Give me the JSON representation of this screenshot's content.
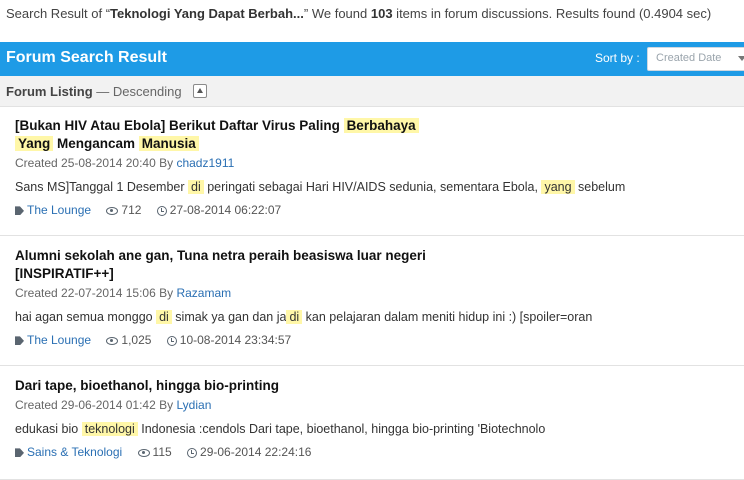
{
  "search_summary": {
    "prefix": "Search Result of “",
    "query": "Teknologi Yang Dapat Berbah...",
    "middle": "” We found ",
    "count": "103",
    "suffix": " items in forum discussions. Results found (0.4904 sec)"
  },
  "header": {
    "title": "Forum Search Result",
    "sort_label": "Sort by :",
    "sort_value": "Created Date"
  },
  "listing": {
    "label": "Forum Listing",
    "order": " — Descending"
  },
  "results": [
    {
      "title_parts": [
        "[Bukan HIV Atau Ebola] Berikut Daftar Virus Paling ",
        "Berbahaya",
        "Yang",
        " Mengancam ",
        "Manusia"
      ],
      "created_text": "Created 25-08-2014 20:40 By ",
      "author": "chadz1911",
      "snippet_parts": [
        "Sans MS]Tanggal 1 Desember ",
        "di",
        " peringati sebagai Hari HIV/AIDS sedunia, sementara Ebola, ",
        "yang",
        " sebelum"
      ],
      "forum": "The Lounge",
      "views": "712",
      "last_post": "27-08-2014 06:22:07"
    },
    {
      "title": "Alumni sekolah ane gan, Tuna netra peraih beasiswa luar negeri [INSPIRATIF++]",
      "created_text": "Created 22-07-2014 15:06 By ",
      "author": "Razamam",
      "snippet_parts": [
        "hai agan semua monggo ",
        "di",
        " simak ya gan dan ja",
        "di",
        " kan pelajaran dalam meniti hidup ini :) [spoiler=oran"
      ],
      "forum": "The Lounge",
      "views": "1,025",
      "last_post": "10-08-2014 23:34:57"
    },
    {
      "title": "Dari tape, bioethanol, hingga bio-printing",
      "created_text": "Created 29-06-2014 01:42 By ",
      "author": "Lydian",
      "snippet_parts": [
        "edukasi bio ",
        "teknologi",
        " Indonesia :cendols Dari tape, bioethanol, hingga bio-printing 'Biotechnolo"
      ],
      "forum": "Sains & Teknologi",
      "views": "115",
      "last_post": "29-06-2014 22:24:16"
    }
  ]
}
